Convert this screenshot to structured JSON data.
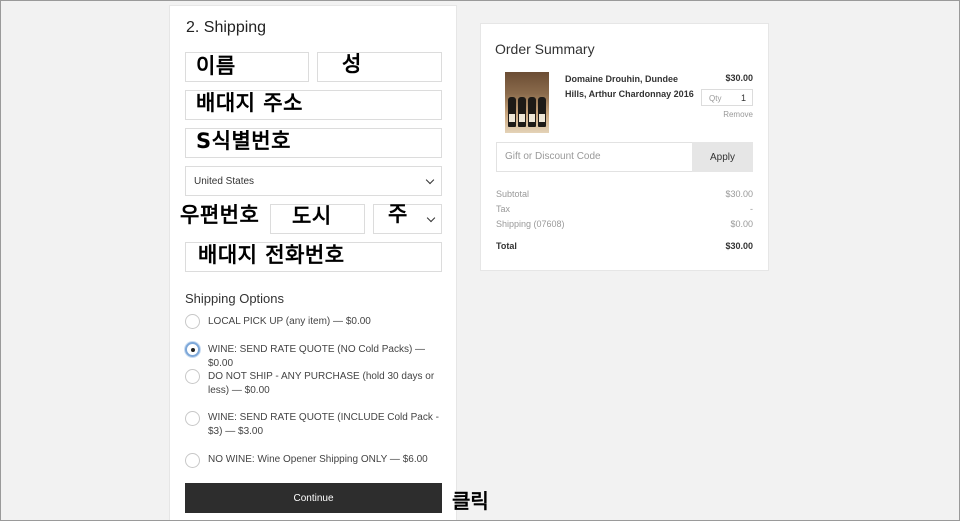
{
  "shipping": {
    "step_title": "2.  Shipping",
    "fields": {
      "first_name": "이름",
      "last_name": "성",
      "address": "배대지 주소",
      "address2": "S식별번호",
      "country": "United States",
      "zip": "우편번호",
      "city": "도시",
      "state": "주",
      "phone": "배대지 전화번호"
    },
    "options_title": "Shipping Options",
    "options": [
      {
        "label": "LOCAL PICK UP (any item) — $0.00",
        "selected": false
      },
      {
        "label": "WINE: SEND RATE QUOTE (NO Cold Packs) — $0.00",
        "selected": true
      },
      {
        "label": "DO NOT SHIP - ANY PURCHASE (hold 30 days or less) — $0.00",
        "selected": false
      },
      {
        "label": "WINE: SEND RATE QUOTE (INCLUDE Cold Pack - $3) — $3.00",
        "selected": false
      },
      {
        "label": "NO WINE: Wine Opener Shipping ONLY — $6.00",
        "selected": false
      }
    ],
    "continue_label": "Continue",
    "click_note": "클릭"
  },
  "summary": {
    "title": "Order Summary",
    "product_name": "Domaine Drouhin, Dundee Hills, Arthur Chardonnay 2016",
    "product_price": "$30.00",
    "qty_label": "Qty",
    "qty_value": "1",
    "remove_label": "Remove",
    "gift_placeholder": "Gift or Discount Code",
    "apply_label": "Apply",
    "rows": [
      {
        "label": "Subtotal",
        "value": "$30.00"
      },
      {
        "label": "Tax",
        "value": "-"
      },
      {
        "label": "Shipping (07608)",
        "value": "$0.00"
      },
      {
        "label": "Total",
        "value": "$30.00"
      }
    ]
  },
  "colors": {
    "page_bg": "#f2f2f2",
    "button_dark": "#2d2d2d",
    "selected_radio": "#7da7d8"
  }
}
